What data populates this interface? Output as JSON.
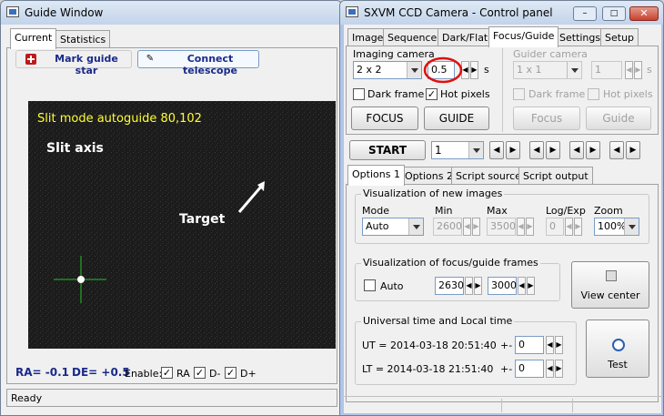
{
  "guide": {
    "title": "Guide Window",
    "tabs": [
      "Current",
      "Statistics"
    ],
    "mark_button": "Mark guide star",
    "connect_button": "Connect telescope",
    "image_title": "Slit mode autoguide  80,102",
    "slit_axis": "Slit axis",
    "target": "Target",
    "ra": "RA= -0.1",
    "de": "DE= +0.5",
    "enable": "Enable:",
    "ra_cb": "RA",
    "dminus": "D-",
    "dplus": "D+",
    "status": "Ready"
  },
  "ccd": {
    "title": "SXVM CCD Camera - Control panel",
    "tabs": [
      "Image",
      "Sequence",
      "Dark/Flat",
      "Focus/Guide",
      "Settings",
      "Setup"
    ],
    "imaging_label": "Imaging camera",
    "binning": "2 x 2",
    "exposure": "0.5",
    "unit": "s",
    "dark_frame": "Dark frame",
    "hot_pixels": "Hot pixels",
    "focus": "FOCUS",
    "guide": "GUIDE",
    "guider_label": "Guider camera",
    "g_binning": "1 x 1",
    "g_exposure": "1",
    "g_unit": "s",
    "g_dark": "Dark frame",
    "g_hot": "Hot pixels",
    "g_focus": "Focus",
    "g_guide": "Guide",
    "start": "START",
    "count": "1",
    "opt_tabs": [
      "Options 1",
      "Options 2",
      "Script source",
      "Script output"
    ],
    "vis_new": "Visualization of new images",
    "mode_lbl": "Mode",
    "min_lbl": "Min",
    "max_lbl": "Max",
    "log_lbl": "Log/Exp",
    "zoom_lbl": "Zoom",
    "mode": "Auto",
    "min": "2600",
    "max": "3500",
    "log": "0",
    "zoom": "100%",
    "vis_focus": "Visualization of focus/guide frames",
    "auto": "Auto",
    "f_min": "2630",
    "f_max": "3000",
    "view_center": "View center",
    "ut_group": "Universal time and Local time",
    "ut": "UT = 2014-03-18 20:51:40",
    "lt": "LT = 2014-03-18 21:51:40",
    "pm": "+-",
    "ut_off": "0",
    "lt_off": "0",
    "test": "Test"
  }
}
